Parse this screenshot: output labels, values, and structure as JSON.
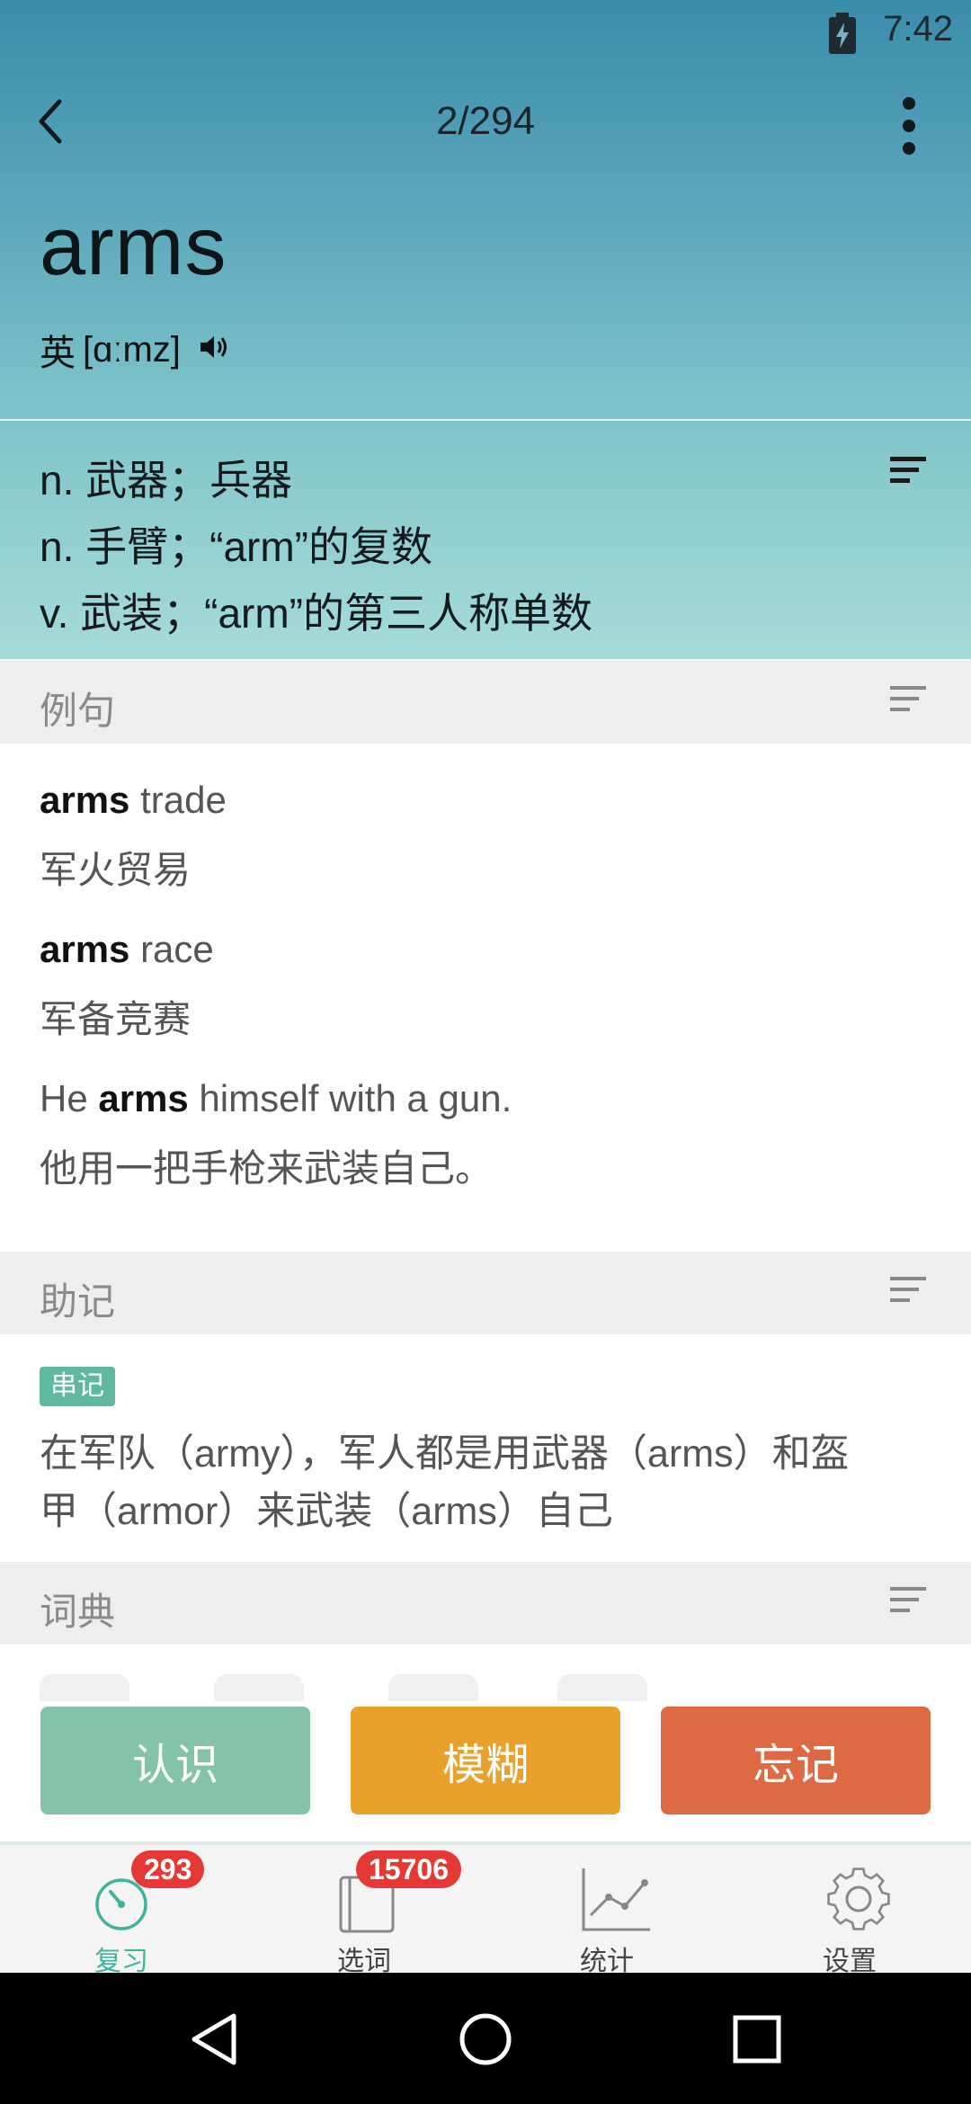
{
  "status_bar": {
    "time": "7:42"
  },
  "header": {
    "page_counter": "2/294",
    "word": "arms",
    "pron_label": "英",
    "phonetic": "[ɑːmz]"
  },
  "definitions": [
    "n. 武器；兵器",
    "n. 手臂；“arm”的复数",
    "v. 武装；“arm”的第三人称单数"
  ],
  "examples_section": {
    "title": "例句",
    "items": [
      {
        "keyword": "arms",
        "pre": "",
        "post": " trade",
        "zh": "军火贸易"
      },
      {
        "keyword": "arms",
        "pre": "",
        "post": " race",
        "zh": "军备竞赛"
      },
      {
        "keyword": "arms",
        "pre": "He ",
        "post": " himself with a gun.",
        "zh": "他用一把手枪来武装自己。"
      }
    ]
  },
  "mnemonic_section": {
    "title": "助记",
    "tag": "串记",
    "lines": [
      "在军队（army），军人都是用武器（arms）和盔",
      "甲（armor）来武装（arms）自己"
    ]
  },
  "dictionary_section": {
    "title": "词典"
  },
  "actions": {
    "know": "认识",
    "fuzzy": "模糊",
    "forget": "忘记"
  },
  "bottom_nav": {
    "review": {
      "label": "复习",
      "badge": "293"
    },
    "select": {
      "label": "选词",
      "badge": "15706"
    },
    "stats": {
      "label": "统计"
    },
    "settings": {
      "label": "设置"
    }
  },
  "colors": {
    "accent": "#3fb39a",
    "know": "#82c3aa",
    "fuzzy": "#e9a12c",
    "forget": "#de6a43",
    "badge": "#e53935"
  }
}
